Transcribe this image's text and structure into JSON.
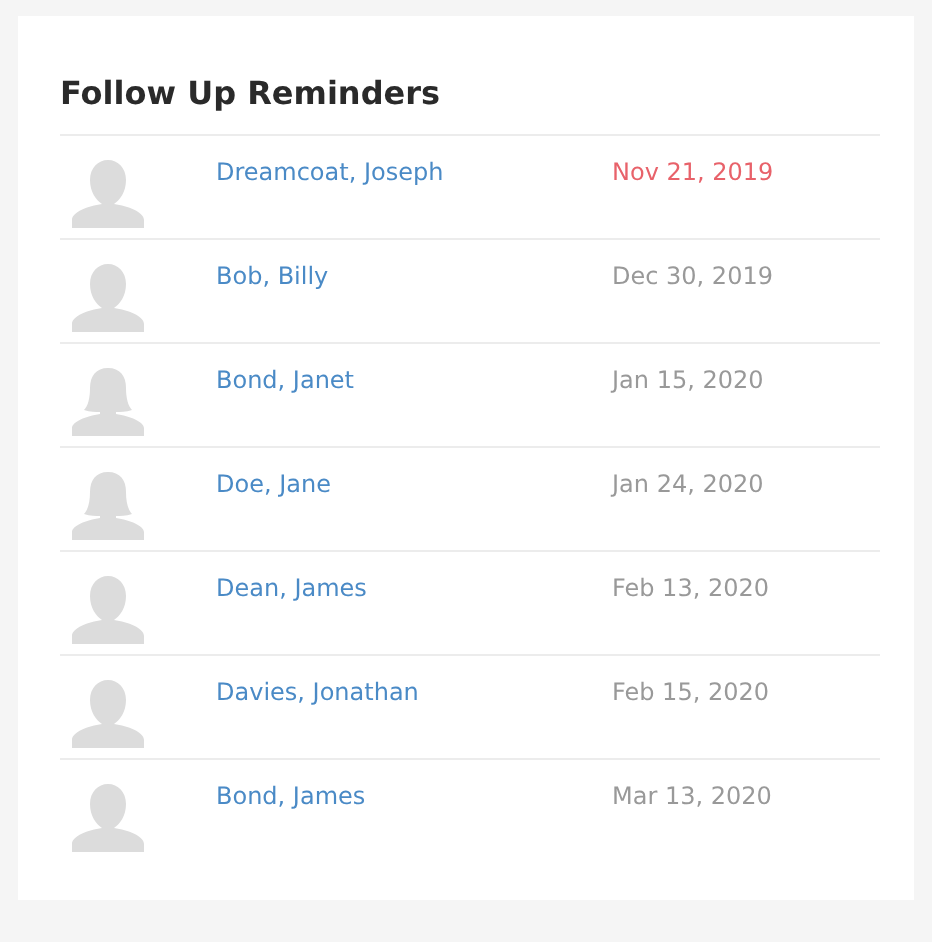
{
  "title": "Follow Up Reminders",
  "reminders": [
    {
      "kind": "male",
      "name": "Dreamcoat, Joseph",
      "date": "Nov 21, 2019",
      "overdue": true
    },
    {
      "kind": "male",
      "name": "Bob, Billy",
      "date": "Dec 30, 2019",
      "overdue": false
    },
    {
      "kind": "female",
      "name": "Bond, Janet",
      "date": "Jan 15, 2020",
      "overdue": false
    },
    {
      "kind": "female",
      "name": "Doe, Jane",
      "date": "Jan 24, 2020",
      "overdue": false
    },
    {
      "kind": "male",
      "name": "Dean, James",
      "date": "Feb 13, 2020",
      "overdue": false
    },
    {
      "kind": "male",
      "name": "Davies, Jonathan",
      "date": "Feb 15, 2020",
      "overdue": false
    },
    {
      "kind": "male",
      "name": "Bond, James",
      "date": "Mar 13, 2020",
      "overdue": false
    }
  ]
}
